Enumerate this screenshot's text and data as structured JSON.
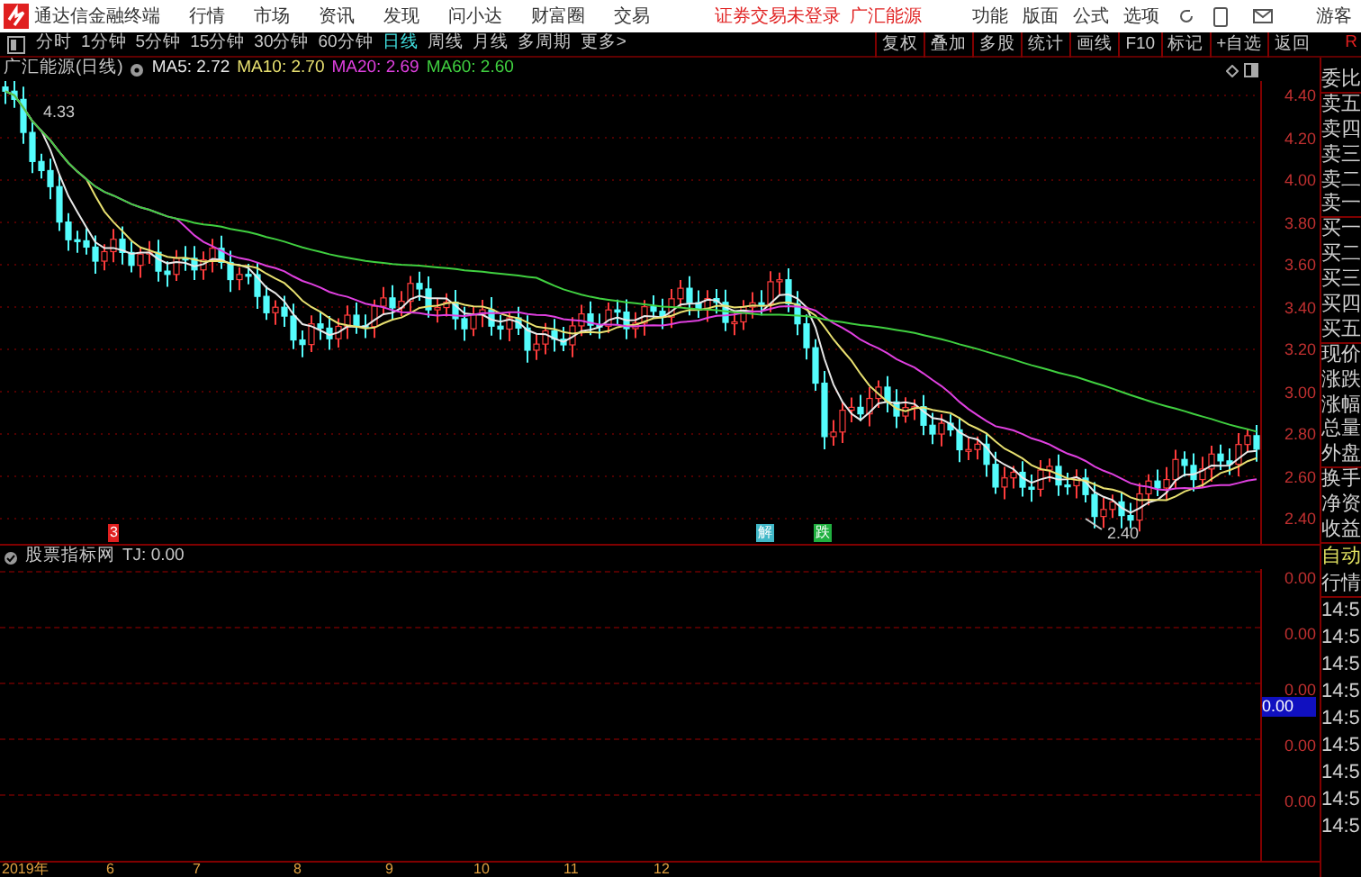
{
  "app_bar": {
    "title": "通达信金融终端",
    "menus": [
      "行情",
      "市场",
      "资讯",
      "发现",
      "问小达",
      "财富圈",
      "交易"
    ],
    "notice": "证券交易未登录",
    "stock_link": "广汇能源",
    "tools": [
      "功能",
      "版面",
      "公式",
      "选项"
    ],
    "user": "游客"
  },
  "toolbar": {
    "periods": [
      {
        "label": "分时",
        "selected": false
      },
      {
        "label": "1分钟",
        "selected": false
      },
      {
        "label": "5分钟",
        "selected": false
      },
      {
        "label": "15分钟",
        "selected": false
      },
      {
        "label": "30分钟",
        "selected": false
      },
      {
        "label": "60分钟",
        "selected": false
      },
      {
        "label": "日线",
        "selected": true
      },
      {
        "label": "周线",
        "selected": false
      },
      {
        "label": "月线",
        "selected": false
      },
      {
        "label": "多周期",
        "selected": false
      },
      {
        "label": "更多>",
        "selected": false
      }
    ],
    "actions": [
      "复权",
      "叠加",
      "多股",
      "统计",
      "画线",
      "F10",
      "标记",
      "+自选",
      "返回"
    ],
    "corner": "R"
  },
  "chart": {
    "title": "广汇能源(日线)",
    "ma": [
      {
        "label": "MA5: 2.72",
        "color": "#e8e8e8"
      },
      {
        "label": "MA10: 2.70",
        "color": "#e8e070"
      },
      {
        "label": "MA20: 2.69",
        "color": "#e040e0"
      },
      {
        "label": "MA60: 2.60",
        "color": "#40d040"
      }
    ],
    "price_axis": [
      "4.40",
      "4.20",
      "4.00",
      "3.80",
      "3.60",
      "3.40",
      "3.20",
      "3.00",
      "2.80",
      "2.60",
      "2.40"
    ],
    "high_label": "4.33",
    "low_label": "2.40",
    "signals": [
      {
        "text": "3",
        "color": "#e02020"
      },
      {
        "text": "解",
        "color": "#40b8c8"
      },
      {
        "text": "跌",
        "color": "#20b040"
      }
    ]
  },
  "indicator": {
    "title": "股票指标网",
    "value": "TJ: 0.00",
    "axis": [
      "0.00",
      "0.00",
      "0.00",
      "0.00",
      "0.00"
    ],
    "cursor_value": "0.00"
  },
  "time_axis": [
    "2019年",
    "6",
    "7",
    "8",
    "9",
    "10",
    "11",
    "12"
  ],
  "quote_panel": {
    "labels": [
      "委比",
      "卖五",
      "卖四",
      "卖三",
      "卖二",
      "卖一",
      "买一",
      "买二",
      "买三",
      "买四",
      "买五",
      "现价",
      "涨跌",
      "涨幅",
      "总量",
      "外盘",
      "换手",
      "净资",
      "收益"
    ],
    "trade_mode": "自动",
    "trade_title": "行情",
    "times": [
      "14:5",
      "14:5",
      "14:5",
      "14:5",
      "14:5",
      "14:5",
      "14:5",
      "14:5",
      "14:5"
    ]
  }
}
